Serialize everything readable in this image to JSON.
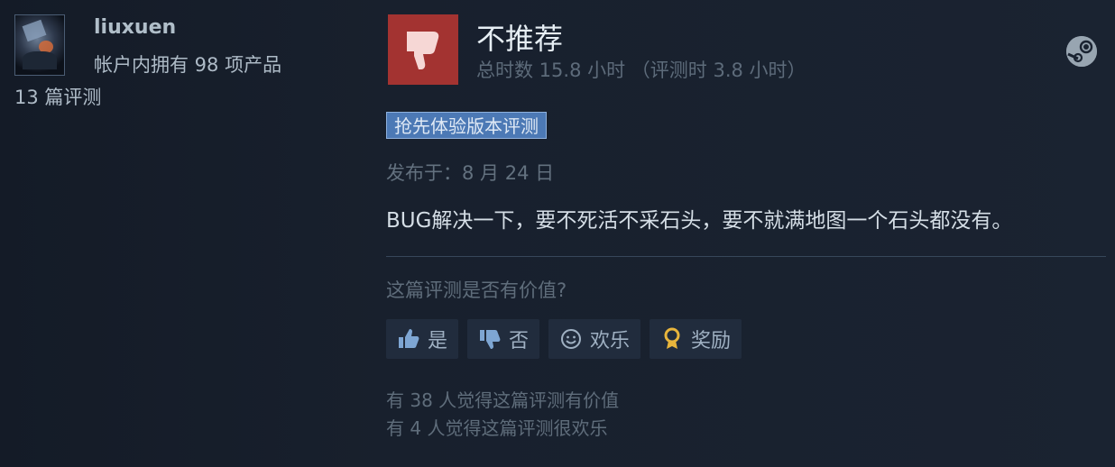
{
  "author": {
    "persona_name": "liuxuen",
    "products_owned": "帐户内拥有 98 项产品",
    "review_count": "13 篇评测"
  },
  "review": {
    "recommendation": "不推荐",
    "hours": "总时数 15.8 小时 （评测时 3.8 小时）",
    "early_access_tag": "抢先体验版本评测",
    "posted": "发布于：8 月 24 日",
    "content": "BUG解决一下，要不死活不采石头，要不就满地图一个石头都没有。"
  },
  "feedback": {
    "question": "这篇评测是否有价值?",
    "buttons": {
      "yes": "是",
      "no": "否",
      "funny": "欢乐",
      "award": "奖励"
    },
    "helpful_stat": "有 38 人觉得这篇评测有价值",
    "funny_stat": "有 4 人觉得这篇评测很欢乐"
  },
  "icons": {
    "recommendation_icon": "thumbs-down-icon",
    "platform_icon": "steam-icon",
    "yes_icon": "thumbs-up-icon",
    "no_icon": "thumbs-down-icon",
    "funny_icon": "smiley-icon",
    "award_icon": "award-icon"
  },
  "colors": {
    "background": "#151b26",
    "not_recommended_box": "#a33331",
    "early_access_tag": "#4c79b5",
    "button_bg": "#212c3d"
  }
}
